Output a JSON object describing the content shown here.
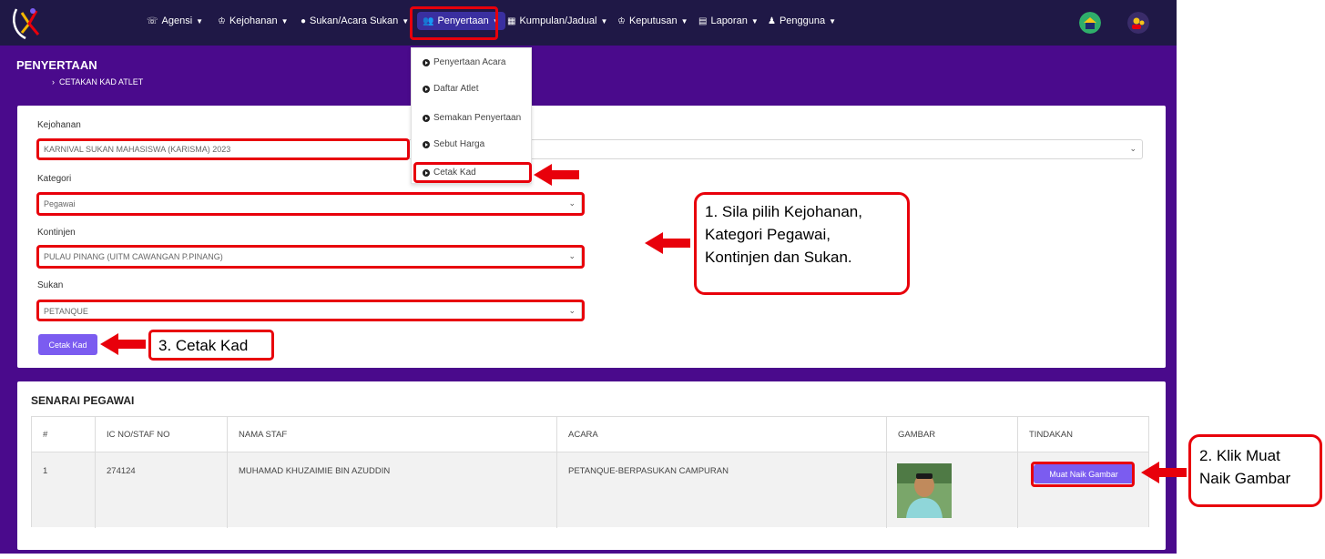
{
  "nav": {
    "items": [
      {
        "icon": "agency-icon",
        "label": "Agensi"
      },
      {
        "icon": "trophy-icon",
        "label": "Kejohanan"
      },
      {
        "icon": "ball-icon",
        "label": "Sukan/Acara Sukan"
      },
      {
        "icon": "users-icon",
        "label": "Penyertaan"
      },
      {
        "icon": "calendar-icon",
        "label": "Kumpulan/Jadual"
      },
      {
        "icon": "trophy-icon",
        "label": "Keputusan"
      },
      {
        "icon": "document-icon",
        "label": "Laporan"
      },
      {
        "icon": "user-icon",
        "label": "Pengguna"
      }
    ]
  },
  "header": {
    "title": "PENYERTAAN",
    "breadcrumb": "CETAKAN KAD ATLET"
  },
  "dropdown": {
    "items": [
      "Penyertaan Acara",
      "Daftar Atlet",
      "Semakan Penyertaan",
      "Sebut Harga",
      "Cetak Kad"
    ]
  },
  "form": {
    "kejohanan_label": "Kejohanan",
    "kejohanan_value": "KARNIVAL SUKAN MAHASISWA (KARISMA) 2023",
    "kategori_label": "Kategori",
    "kategori_value": "Pegawai",
    "kontinjen_label": "Kontinjen",
    "kontinjen_value": "PULAU PINANG (UITM CAWANGAN P.PINANG)",
    "sukan_label": "Sukan",
    "sukan_value": "PETANQUE",
    "cetak_button": "Cetak Kad"
  },
  "annotations": {
    "step1": [
      "1. Sila pilih Kejohanan,",
      "Kategori Pegawai,",
      "Kontinjen dan Sukan."
    ],
    "step2": [
      "2. Klik Muat",
      "Naik Gambar"
    ],
    "step3": "3. Cetak Kad"
  },
  "table": {
    "title": "SENARAI PEGAWAI",
    "headers": [
      "#",
      "IC NO/STAF NO",
      "NAMA STAF",
      "ACARA",
      "GAMBAR",
      "TINDAKAN"
    ],
    "rows": [
      {
        "no": "1",
        "ic": "274124",
        "nama": "MUHAMAD KHUZAIMIE BIN AZUDDIN",
        "acara": "PETANQUE-BERPASUKAN CAMPURAN",
        "action": "Muat Naik Gambar"
      }
    ]
  },
  "colors": {
    "navbar": "#1f1846",
    "band": "#4a0a8c",
    "button": "#7b5cf0",
    "highlight": "#e8000b"
  }
}
